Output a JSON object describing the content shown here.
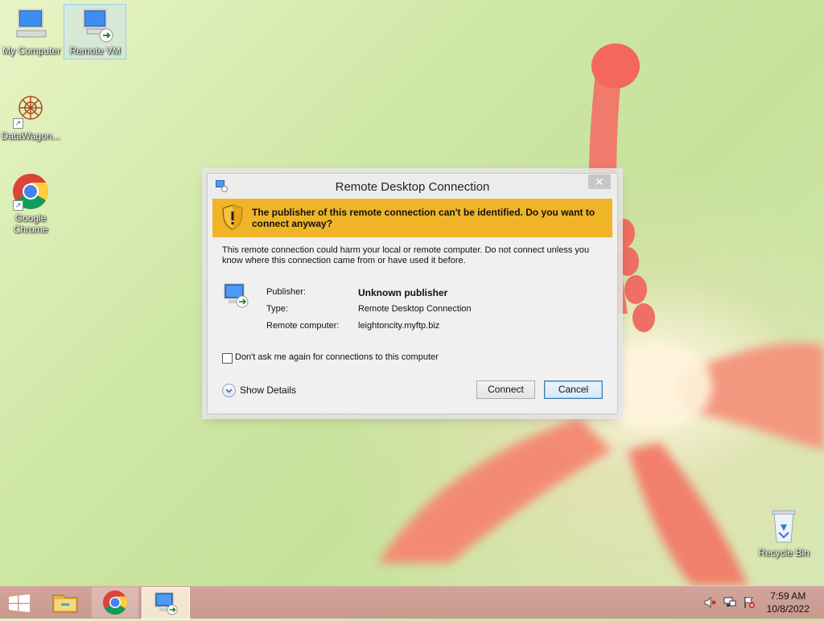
{
  "desktop": {
    "icons": [
      {
        "label": "My Computer"
      },
      {
        "label": "Remote VM"
      },
      {
        "label": "DataWagon..."
      },
      {
        "label": "Google Chrome"
      },
      {
        "label": "Recycle Bin"
      }
    ]
  },
  "dialog": {
    "title": "Remote Desktop Connection",
    "close_glyph": "✕",
    "warning": "The publisher of this remote connection can't be identified. Do you want to connect anyway?",
    "description": "This remote connection could harm your local or remote computer. Do not connect unless you know where this connection came from or have used it before.",
    "fields": [
      {
        "label": "Publisher:",
        "value": "Unknown publisher"
      },
      {
        "label": "Type:",
        "value": "Remote Desktop Connection"
      },
      {
        "label": "Remote computer:",
        "value": "leightoncity.myftp.biz"
      }
    ],
    "checkbox_label": "Don't ask me again for connections to this computer",
    "show_details": "Show Details",
    "connect_label": "Connect",
    "cancel_label": "Cancel"
  },
  "taskbar": {
    "time": "7:59 AM",
    "date": "10/8/2022"
  },
  "colors": {
    "warning_bar": "#f0b428",
    "taskbar": "#c99c92",
    "default_button_border": "#3c7fb1"
  },
  "icons": [
    "windows-start-icon",
    "file-explorer-icon",
    "chrome-icon",
    "remote-desktop-icon",
    "volume-muted-icon",
    "network-icon",
    "action-center-icon"
  ]
}
